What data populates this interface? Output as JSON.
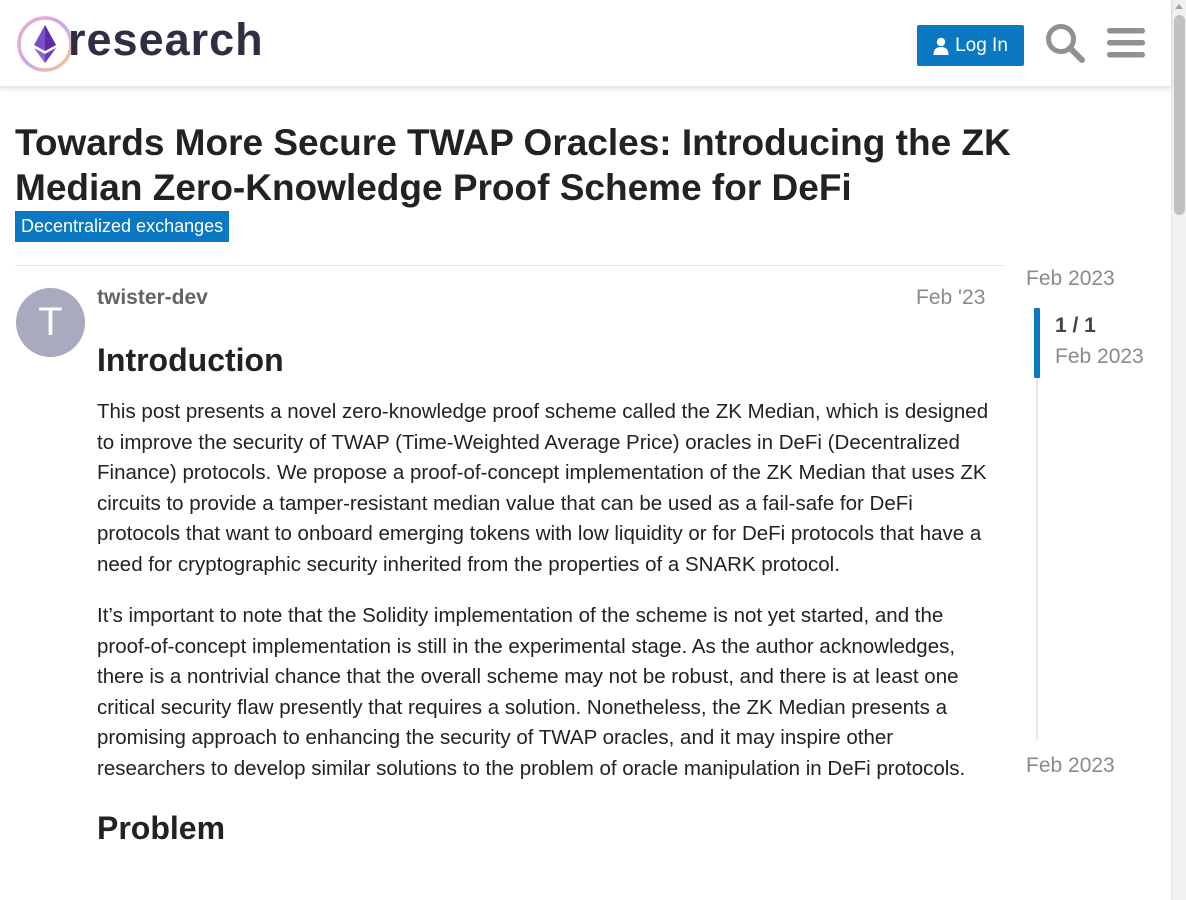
{
  "header": {
    "logo_text": "research",
    "login_label": "Log In",
    "accent_color": "#0a78c2"
  },
  "topic": {
    "title": "Towards More Secure TWAP Oracles: Introducing the ZK Median Zero-Knowledge Proof Scheme for DeFi",
    "category": "Decentralized exchanges"
  },
  "post": {
    "avatar_letter": "T",
    "username": "twister-dev",
    "date": "Feb '23",
    "heading": "Introduction",
    "paragraphs": [
      "This post presents a novel zero-knowledge proof scheme called the ZK Median, which is designed to improve the security of TWAP (Time-Weighted Average Price) oracles in DeFi (Decentralized Finance) protocols. We propose a proof-of-concept implementation of the ZK Median that uses ZK circuits to provide a tamper-resistant median value that can be used as a fail-safe for DeFi protocols that want to onboard emerging tokens with low liquidity or for DeFi protocols that have a need for cryptographic security inherited from the properties of a SNARK protocol.",
      "It’s important to note that the Solidity implementation of the scheme is not yet started, and the proof-of-concept implementation is still in the experimental stage. As the author acknowledges, there is a nontrivial chance that the overall scheme may not be robust, and there is at least one critical security flaw presently that requires a solution. Nonetheless, the ZK Median presents a promising approach to enhancing the security of TWAP oracles, and it may inspire other researchers to develop similar solutions to the problem of oracle manipulation in DeFi protocols."
    ],
    "next_heading": "Problem"
  },
  "timeline": {
    "start_date": "Feb 2023",
    "count": "1 / 1",
    "current_date": "Feb 2023",
    "end_date": "Feb 2023"
  }
}
